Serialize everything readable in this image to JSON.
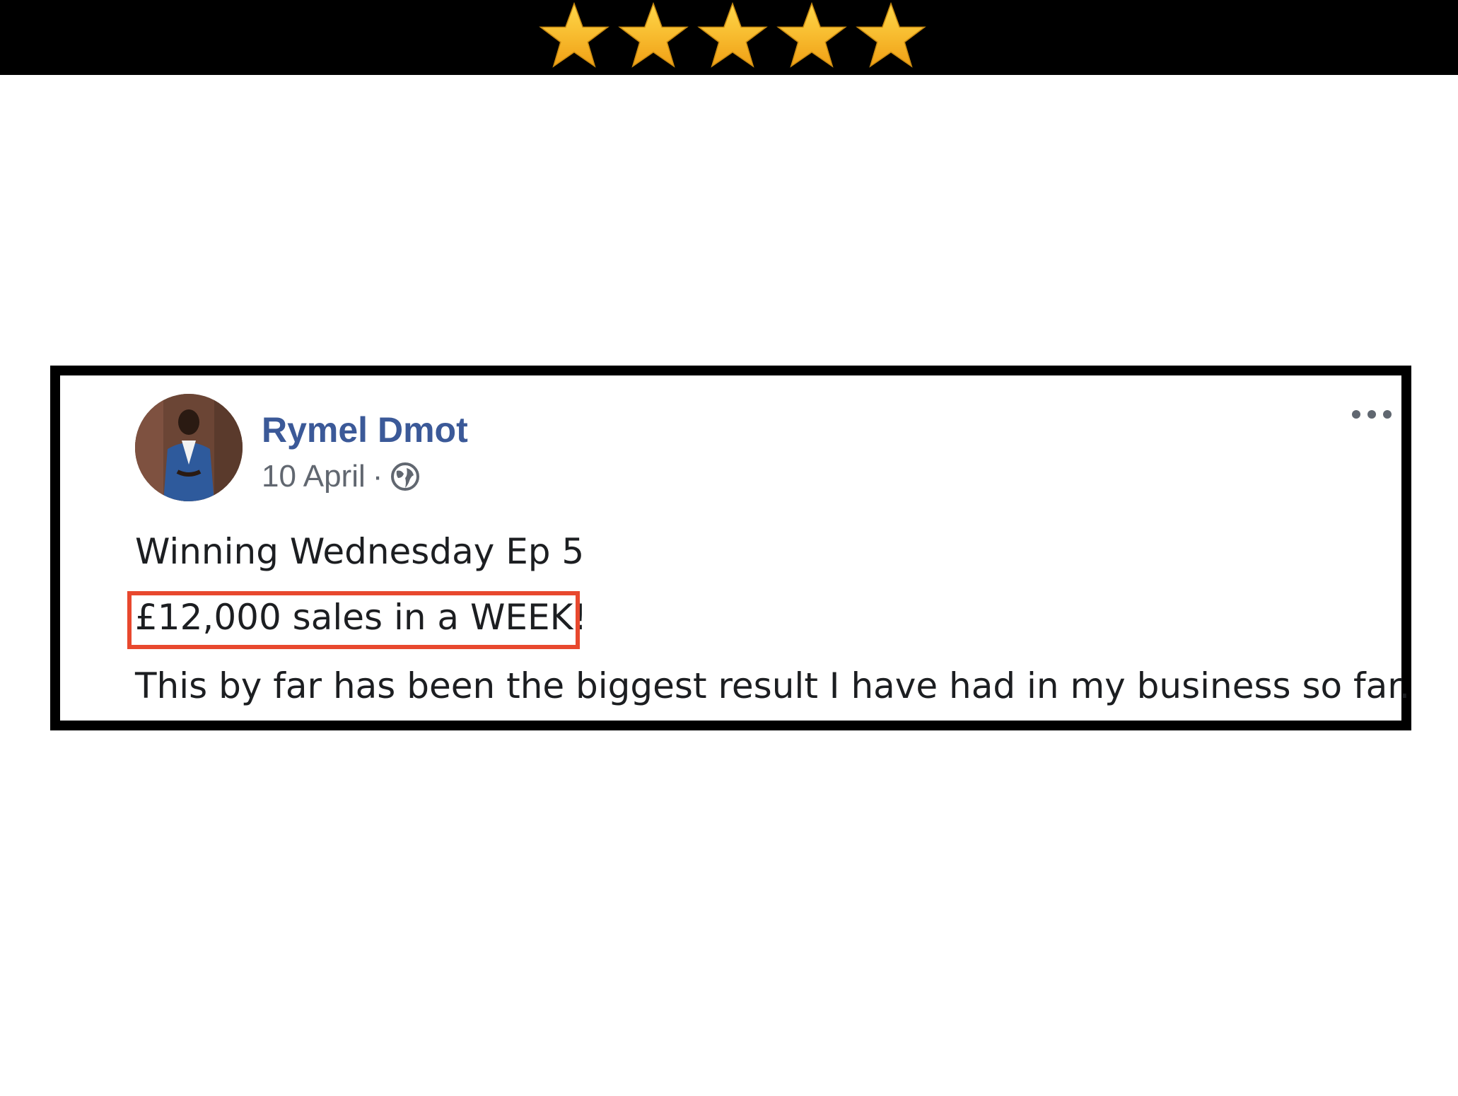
{
  "rating": {
    "stars": 5,
    "max_stars": 5,
    "star_color": "#f7b825",
    "bar_color": "#000000"
  },
  "post": {
    "author_name": "Rymel Dmot",
    "date": "10 April",
    "separator": "·",
    "audience_icon": "globe-icon",
    "menu_icon": "more-options-icon",
    "text_lines": [
      "Winning Wednesday Ep 5",
      "£12,000 sales in a WEEK!",
      "This by far has been the biggest result I have had in my business so far."
    ],
    "highlighted_line_index": 1,
    "highlight_color": "#e8482e",
    "name_color": "#3b5998"
  }
}
